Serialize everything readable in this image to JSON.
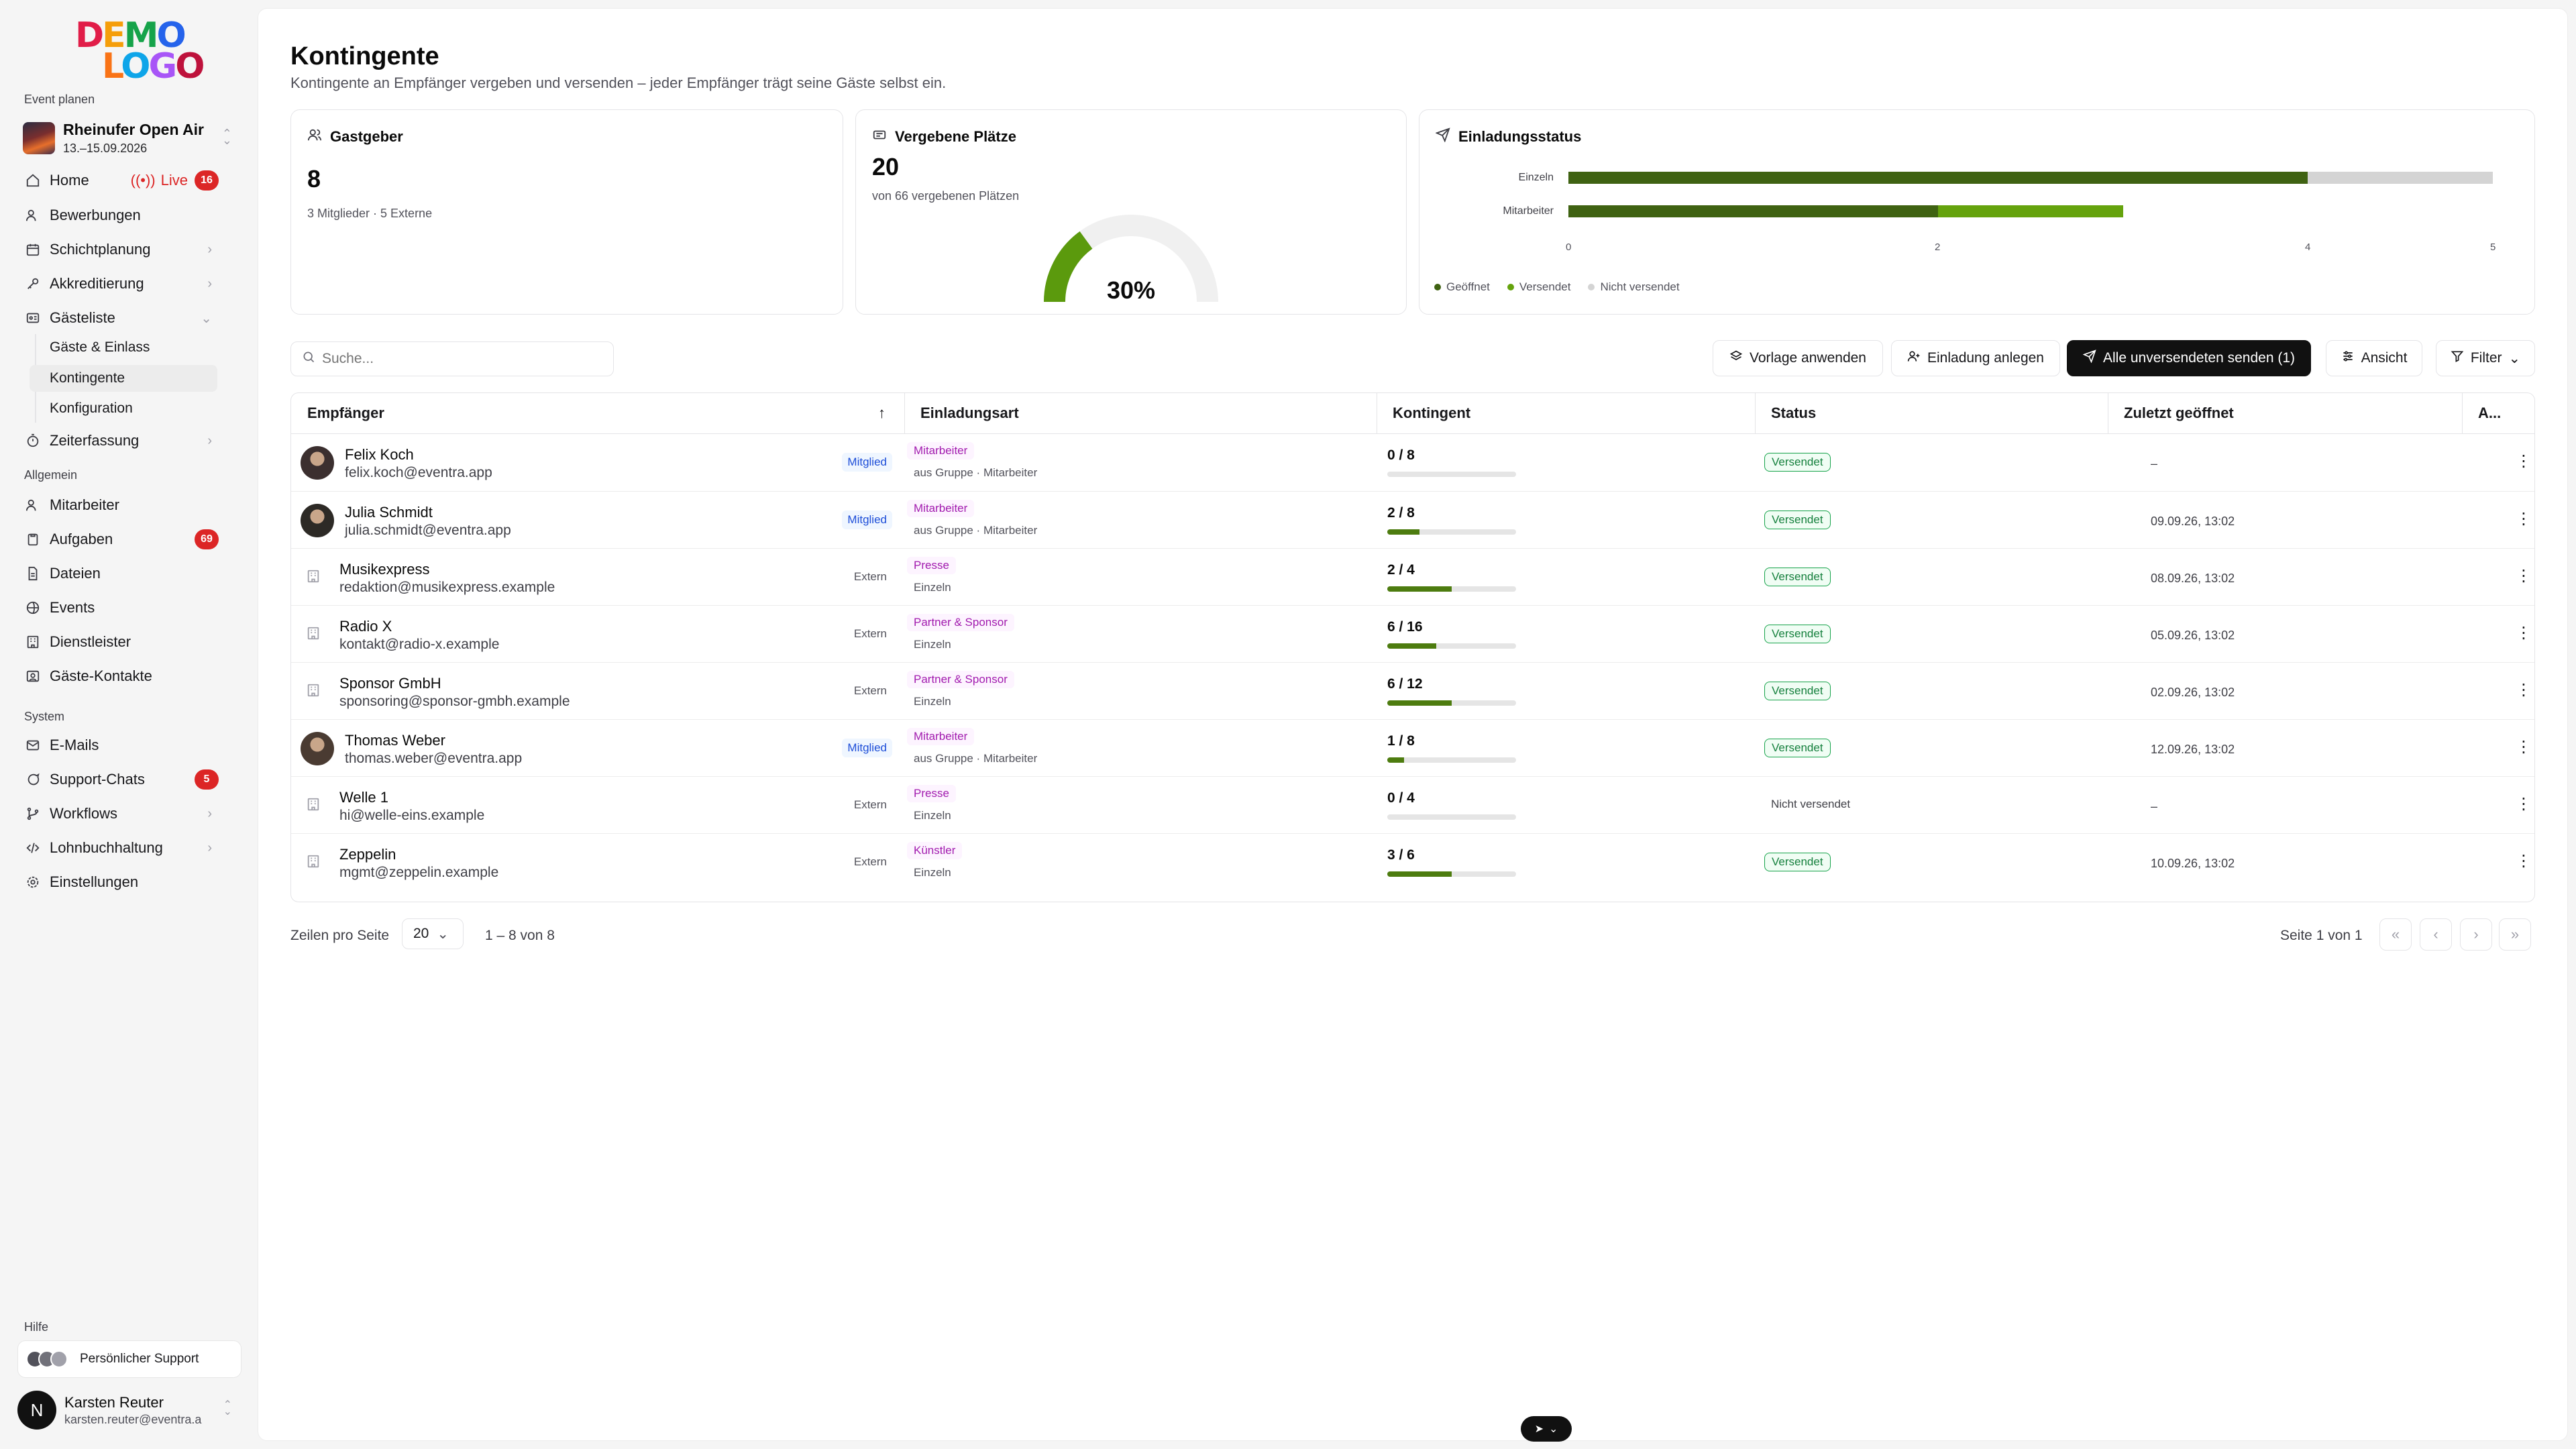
{
  "sidebar": {
    "logo_line1": "DEMO",
    "logo_line2": "LOGO",
    "section_event": "Event planen",
    "event": {
      "name": "Rheinufer Open Air",
      "date": "13.–15.09.2026"
    },
    "home": "Home",
    "live_label": "Live",
    "live_count": "16",
    "bewerbungen": "Bewerbungen",
    "schichtplanung": "Schichtplanung",
    "akkreditierung": "Akkreditierung",
    "gaesteliste": "Gästeliste",
    "sub_gaeste": "Gäste & Einlass",
    "sub_kontingente": "Kontingente",
    "sub_konfiguration": "Konfiguration",
    "zeiterfassung": "Zeiterfassung",
    "section_allgemein": "Allgemein",
    "mitarbeiter": "Mitarbeiter",
    "aufgaben": "Aufgaben",
    "aufgaben_count": "69",
    "dateien": "Dateien",
    "events": "Events",
    "dienstleister": "Dienstleister",
    "gaeste_kontakte": "Gäste-Kontakte",
    "section_system": "System",
    "emails": "E-Mails",
    "support_chats": "Support-Chats",
    "support_count": "5",
    "workflows": "Workflows",
    "lohnbuchhaltung": "Lohnbuchhaltung",
    "einstellungen": "Einstellungen",
    "section_hilfe": "Hilfe",
    "support_button": "Persönlicher Support",
    "user": {
      "initial": "N",
      "name": "Karsten Reuter",
      "email": "karsten.reuter@eventra.a"
    }
  },
  "page": {
    "title": "Kontingente",
    "subtitle": "Kontingente an Empfänger vergeben und versenden – jeder Empfänger trägt seine Gäste selbst ein."
  },
  "cards": {
    "gastgeber": {
      "title": "Gastgeber",
      "value": "8",
      "detail": "3 Mitglieder · 5 Externe"
    },
    "plaetze": {
      "title": "Vergebene Plätze",
      "value": "20",
      "detail": "von 66 vergebenen Plätzen",
      "gauge_label": "30%",
      "gauge_fraction": 0.3
    },
    "status": {
      "title": "Einladungsstatus",
      "rows": [
        {
          "label": "Einzeln",
          "opened": 4,
          "sent": 0,
          "max": 5
        },
        {
          "label": "Mitarbeiter",
          "opened": 2,
          "sent": 1,
          "max": 3
        }
      ],
      "ticks": [
        "0",
        "2",
        "4",
        "5"
      ],
      "legend": {
        "opened": "Geöffnet",
        "sent": "Versendet",
        "not_sent": "Nicht versendet"
      },
      "colors": {
        "opened": "#3f6212",
        "sent": "#65a30d",
        "not_sent": "#d4d4d4"
      }
    }
  },
  "toolbar": {
    "search_placeholder": "Suche...",
    "vorlage": "Vorlage anwenden",
    "einladung": "Einladung anlegen",
    "senden": "Alle unversendeten senden (1)",
    "ansicht": "Ansicht",
    "filter": "Filter"
  },
  "table": {
    "headers": {
      "empfaenger": "Empfänger",
      "art": "Einladungsart",
      "kontingent": "Kontingent",
      "status": "Status",
      "geoeffnet": "Zuletzt geöffnet",
      "actions": "A..."
    },
    "rows": [
      {
        "name": "Felix Koch",
        "email": "felix.koch@eventra.app",
        "tag": "Mitglied",
        "type": "Mitarbeiter",
        "type_sub": "aus Gruppe · Mitarbeiter",
        "quota": "0 / 8",
        "fill": 0.0,
        "status": "Versendet",
        "opened": "–"
      },
      {
        "name": "Julia Schmidt",
        "email": "julia.schmidt@eventra.app",
        "tag": "Mitglied",
        "type": "Mitarbeiter",
        "type_sub": "aus Gruppe · Mitarbeiter",
        "quota": "2 / 8",
        "fill": 0.25,
        "status": "Versendet",
        "opened": "09.09.26, 13:02"
      },
      {
        "name": "Musikexpress",
        "email": "redaktion@musikexpress.example",
        "tag": "Extern",
        "type": "Presse",
        "type_sub": "Einzeln",
        "quota": "2 / 4",
        "fill": 0.5,
        "status": "Versendet",
        "opened": "08.09.26, 13:02"
      },
      {
        "name": "Radio X",
        "email": "kontakt@radio-x.example",
        "tag": "Extern",
        "type": "Partner & Sponsor",
        "type_sub": "Einzeln",
        "quota": "6 / 16",
        "fill": 0.375,
        "status": "Versendet",
        "opened": "05.09.26, 13:02"
      },
      {
        "name": "Sponsor GmbH",
        "email": "sponsoring@sponsor-gmbh.example",
        "tag": "Extern",
        "type": "Partner & Sponsor",
        "type_sub": "Einzeln",
        "quota": "6 / 12",
        "fill": 0.5,
        "status": "Versendet",
        "opened": "02.09.26, 13:02"
      },
      {
        "name": "Thomas Weber",
        "email": "thomas.weber@eventra.app",
        "tag": "Mitglied",
        "type": "Mitarbeiter",
        "type_sub": "aus Gruppe · Mitarbeiter",
        "quota": "1 / 8",
        "fill": 0.125,
        "status": "Versendet",
        "opened": "12.09.26, 13:02"
      },
      {
        "name": "Welle 1",
        "email": "hi@welle-eins.example",
        "tag": "Extern",
        "type": "Presse",
        "type_sub": "Einzeln",
        "quota": "0 / 4",
        "fill": 0.0,
        "status": "Nicht versendet",
        "opened": "–"
      },
      {
        "name": "Zeppelin",
        "email": "mgmt@zeppelin.example",
        "tag": "Extern",
        "type": "Künstler",
        "type_sub": "Einzeln",
        "quota": "3 / 6",
        "fill": 0.5,
        "status": "Versendet",
        "opened": "10.09.26, 13:02"
      }
    ]
  },
  "pagination": {
    "rows_label": "Zeilen pro Seite",
    "rows_value": "20",
    "range": "1 – 8 von 8",
    "page": "Seite 1 von 1"
  }
}
